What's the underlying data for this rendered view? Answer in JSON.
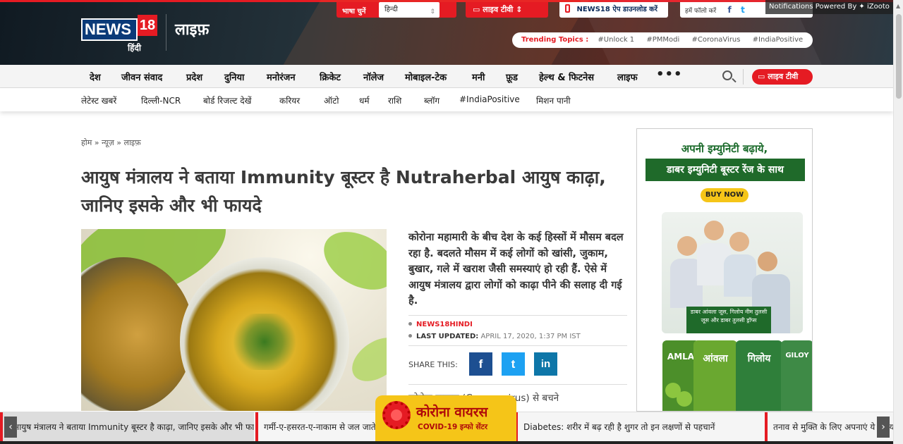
{
  "header": {
    "logo": {
      "text": "NEWS",
      "num": "18",
      "sub": "हिंदी"
    },
    "section_title": "लाइफ़",
    "language": {
      "label": "भाषा चुनें",
      "selected": "हिन्दी"
    },
    "live_tv": "लाइव टीवी",
    "app_download": "NEWS18 ऐप डाउनलोड करें",
    "follow_label": "हमें फॉलो करें",
    "notification": "Notifications Powered By  ✦ iZooto",
    "trending": {
      "label": "Trending Topics :",
      "topics": [
        "#Unlock 1",
        "#PMModi",
        "#CoronaVirus",
        "#IndiaPositive"
      ]
    }
  },
  "nav_primary": [
    "देश",
    "जीवन संवाद",
    "प्रदेश",
    "दुनिया",
    "मनोरंजन",
    "क्रिकेट",
    "नॉलेज",
    "मोबाइल-टेक",
    "मनी",
    "फ़ूड",
    "हेल्थ & फिटनेस",
    "लाइफ"
  ],
  "nav_more": "•••",
  "nav_live_tv": "लाइव टीवी",
  "nav_secondary": [
    "लेटेस्ट खबरें",
    "दिल्ली-NCR",
    "बोर्ड रिजल्ट देखें",
    "करियर",
    "ऑटो",
    "धर्म",
    "राशि",
    "ब्लॉग",
    "#IndiaPositive",
    "मिशन पानी"
  ],
  "article": {
    "breadcrumb": "होम » न्यूज़ » लाइफ़",
    "headline": "आयुष मंत्रालय ने बताया Immunity बूस्टर है Nutraherbal आयुष काढ़ा, जानिए इसके और भी फायदे",
    "lede": "कोरोना महामारी के बीच देश के कई हिस्सों में मौसम बदल रहा है. बदलते मौसम में कई लोगों को खांसी, जुकाम, बुखार, गले में खराश जैसी समस्याएं हो रही हैं. ऐसे में आयुष मंत्रालय द्वारा लोगों को काढ़ा पीने की सलाह दी गई है.",
    "source": "NEWS18HINDI",
    "updated_label": "LAST UPDATED:",
    "updated_value": "APRIL 17, 2020, 1:37 PM IST",
    "share_label": "SHARE THIS:",
    "body_start": "कोरोना वायरस (Corona virus) से बचने"
  },
  "ad": {
    "line1": "अपनी इम्युनिटी बढ़ाये,",
    "line2": "डाबर इम्युनिटी बूस्टर रेंज के साथ",
    "cta": "BUY NOW",
    "banner": "डाबर आंवला जूस, गिलोय नीम तुलसी जूस और डाबर तुलसी ड्रॉप्स",
    "bottle1": "AMLA",
    "bottle2": "आंवला",
    "bottle3": "गिलोय",
    "bottle4": "GILOY"
  },
  "ticker": {
    "items": [
      "आयुष मंत्रालय ने बताया Immunity बूस्टर है काढ़ा, जानिए इसके और भी फायदे",
      "गर्मी-ए-हसरत-ए-नाकाम से जल जाते हैं",
      "Diabetes: शरीर में बढ़ रही है शुगर तो इन लक्षणों से पहचानें",
      "तनाव से मुक्ति के लिए अपनाएं ये उपाय"
    ],
    "prev": "‹",
    "next": "›"
  },
  "corona_badge": {
    "title": "कोरोना वायरस",
    "subtitle": "COVID-19 इन्फो सेंटर"
  },
  "colors": {
    "brand_red": "#e51b23",
    "header_dark": "#101a22",
    "ad_green": "#1f6a2a",
    "corona_yellow": "#f5c518"
  }
}
